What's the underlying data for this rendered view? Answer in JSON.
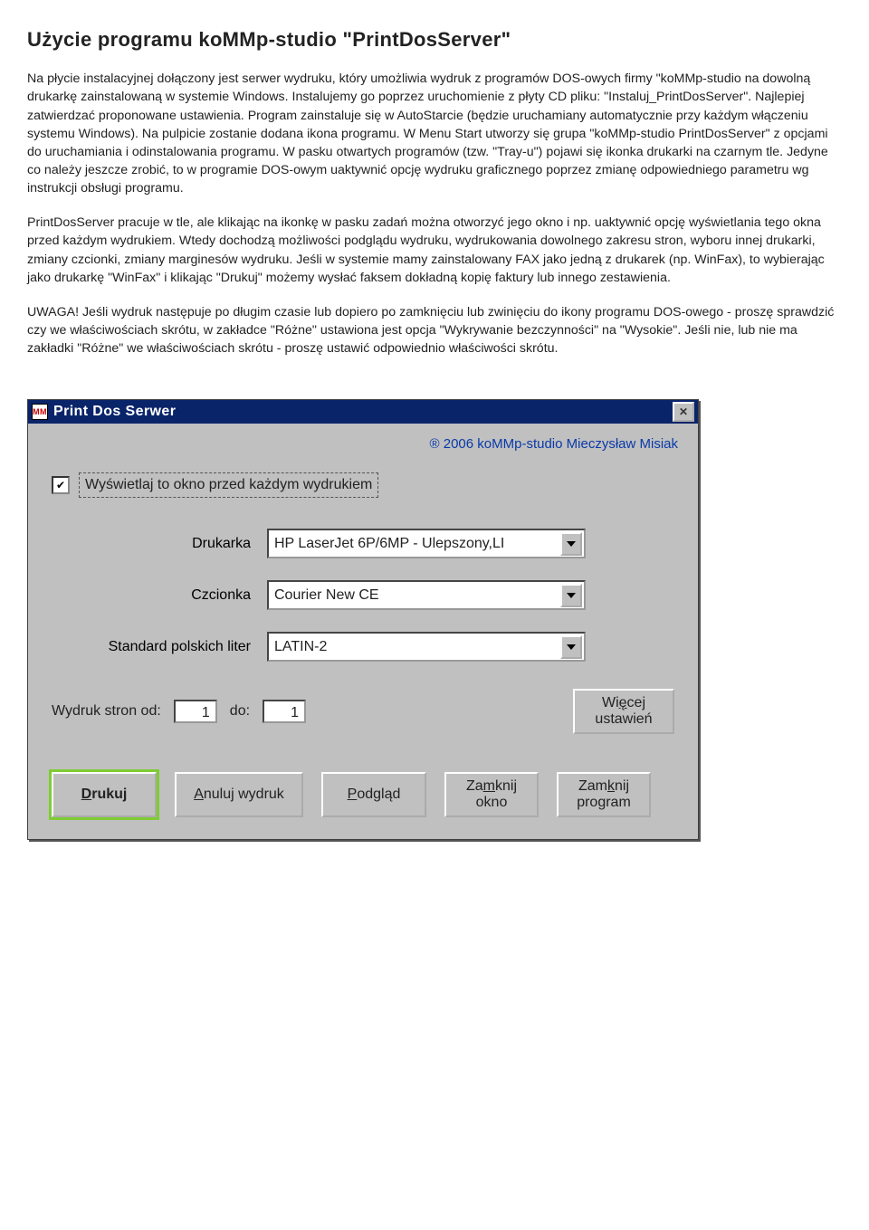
{
  "title": "Użycie programu koMMp-studio \"PrintDosServer\"",
  "para1": "Na płycie instalacyjnej dołączony jest serwer wydruku, który umożliwia wydruk z programów DOS-owych firmy \"koMMp-studio na dowolną drukarkę zainstalowaną w systemie Windows. Instalujemy go poprzez uruchomienie z płyty CD pliku: \"Instaluj_PrintDosServer\". Najlepiej zatwierdzać proponowane ustawienia. Program zainstaluje się w AutoStarcie (będzie uruchamiany automatycznie przy każdym włączeniu systemu Windows). Na pulpicie zostanie dodana ikona programu. W Menu Start utworzy się grupa \"koMMp-studio PrintDosServer\" z opcjami do uruchamiania i odinstalowania programu. W pasku otwartych programów (tzw. \"Tray-u\") pojawi się ikonka drukarki na czarnym tle. Jedyne co należy jeszcze zrobić, to w programie DOS-owym uaktywnić opcję wydruku graficznego poprzez zmianę odpowiedniego parametru wg instrukcji obsługi programu.",
  "para2": "PrintDosServer pracuje w tle, ale klikając na ikonkę w pasku zadań można otworzyć jego okno i np. uaktywnić opcję wyświetlania tego okna przed każdym wydrukiem. Wtedy dochodzą możliwości podglądu wydruku, wydrukowania dowolnego zakresu stron, wyboru innej drukarki, zmiany czcionki, zmiany marginesów wydruku. Jeśli w systemie mamy zainstalowany FAX jako jedną z drukarek (np. WinFax), to wybierając jako drukarkę \"WinFax\" i klikając \"Drukuj\" możemy wysłać faksem dokładną kopię faktury lub innego zestawienia.",
  "para3": "UWAGA! Jeśli wydruk następuje po długim czasie lub dopiero po zamknięciu lub zwinięciu do ikony programu DOS-owego - proszę sprawdzić czy we właściwościach skrótu, w zakładce \"Różne\" ustawiona jest opcja \"Wykrywanie bezczynności\" na \"Wysokie\". Jeśli nie, lub nie ma zakładki \"Różne\" we właściwościach skrótu - proszę ustawić odpowiednio właściwości skrótu.",
  "dialog": {
    "title": "Print Dos Serwer",
    "credits": "® 2006 koMMp-studio  Mieczysław Misiak",
    "checkbox_label": "Wyświetlaj to okno przed każdym wydrukiem",
    "checkbox_checked": "✔",
    "rows": {
      "printer_label": "Drukarka",
      "printer_value": "HP LaserJet 6P/6MP - Ulepszony,LI",
      "font_label": "Czcionka",
      "font_value": "Courier New CE",
      "charset_label": "Standard polskich liter",
      "charset_value": "LATIN-2"
    },
    "pages": {
      "from_label": "Wydruk stron od:",
      "from_value": "1",
      "to_label": "do:",
      "to_value": "1",
      "more_btn_pre": "Wi",
      "more_btn_u": "ę",
      "more_btn_post": "cej\nustawień"
    },
    "buttons": {
      "print_u": "D",
      "print_rest": "rukuj",
      "cancel_u": "A",
      "cancel_rest": "nuluj wydruk",
      "preview_u": "P",
      "preview_rest": "odgląd",
      "close_win_pre": "Za",
      "close_win_u": "m",
      "close_win_post": "knij\nokno",
      "close_prog_pre": "Zam",
      "close_prog_u": "k",
      "close_prog_post": "nij\nprogram"
    }
  }
}
